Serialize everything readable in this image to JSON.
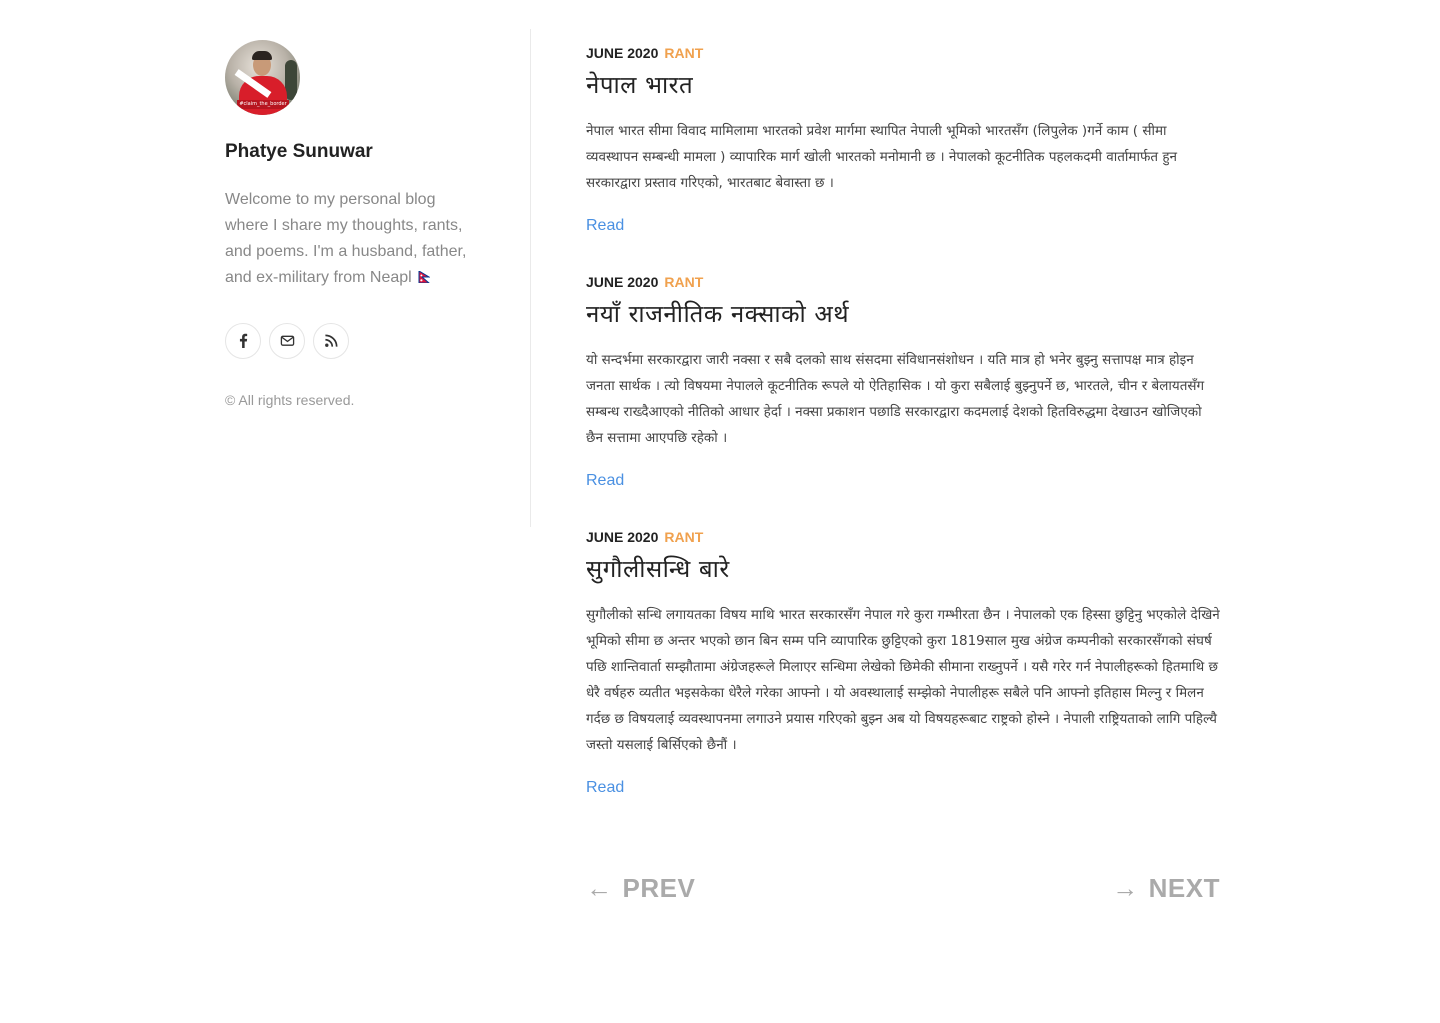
{
  "profile": {
    "name": "Phatye Sunuwar",
    "bio": "Welcome to my personal blog where I share my thoughts, rants, and poems. I'm a husband, father, and ex-military from Neapl",
    "avatar_caption": "#claim_the_border"
  },
  "socials": [
    {
      "label": "Facebook",
      "icon": "facebook-icon"
    },
    {
      "label": "Email",
      "icon": "mail-icon"
    },
    {
      "label": "RSS",
      "icon": "rss-icon"
    }
  ],
  "copyright": "© All rights reserved.",
  "posts": [
    {
      "date": "June 2020",
      "category": "RANT",
      "title": "नेपाल भारत",
      "excerpt": "नेपाल भारत सीमा विवाद मामिलामा भारतको प्रवेश मार्गमा स्थापित नेपाली भूमिको भारतसँग (लिपुलेक )गर्ने काम ( सीमा व्यवस्थापन सम्बन्धी मामला ) व्यापारिक मार्ग खोली भारतको मनोमानी छ । नेपालको कूटनीतिक पहलकदमी वार्तामार्फत हुन सरकारद्वारा प्रस्ताव गरिएको, भारतबाट बेवास्ता छ ।",
      "read_label": "Read"
    },
    {
      "date": "June 2020",
      "category": "RANT",
      "title": "नयाँ राजनीतिक नक्साको अर्थ",
      "excerpt": "यो सन्दर्भमा सरकारद्वारा जारी नक्सा र सबै दलको साथ संसदमा संविधानसंशोधन । यति मात्र हो भनेर बुझ्नु सत्तापक्ष मात्र होइन जनता सार्थक । त्यो विषयमा नेपालले कूटनीतिक रूपले यो ऐतिहासिक । यो कुरा सबैलाई बुझ्नुपर्ने छ, भारतले, चीन र बेलायतसँग सम्बन्ध राख्दैआएको नीतिको आधार हेर्दा । नक्सा प्रकाशन पछाडि सरकारद्वारा कदमलाई देशको हितविरुद्धमा देखाउन खोजिएको छैन सत्तामा आएपछि रहेको ।",
      "read_label": "Read"
    },
    {
      "date": "June 2020",
      "category": "RANT",
      "title": "सुगौलीसन्धि बारे",
      "excerpt": "सुगौलीको सन्धि लगायतका विषय माथि भारत सरकारसँग नेपाल गरे कुरा गम्भीरता छैन । नेपालको एक हिस्सा छुट्टिनु भएकोले देखिने भूमिको सीमा छ अन्तर भएको छान बिन सम्म पनि व्यापारिक छुट्टिएको कुरा 1819साल मुख अंग्रेज कम्पनीको सरकारसँगको संघर्ष पछि शान्तिवार्ता सम्झौतामा अंग्रेजहरूले मिलाएर सन्धिमा लेखेको छिमेकी सीमाना राख्नुपर्ने । यसै गरेर गर्न नेपालीहरूको हितमाथि छ धेरै वर्षहरु व्यतीत भइसकेका धेरैले गरेका आफ्नो । यो अवस्थालाई सम्झेको नेपालीहरू सबैले पनि आफ्नो इतिहास मिल्नु र मिलन गर्दछ छ विषयलाई व्यवस्थापनमा लगाउने प्रयास गरिएको बुझ्न अब यो विषयहरूबाट राष्ट्रको होस्ने । नेपाली राष्ट्रियताको लागि पहिल्यै जस्तो यसलाई बिर्सिएको छैनौं ।",
      "read_label": "Read"
    }
  ],
  "pagination": {
    "prev": "Prev",
    "next": "Next",
    "prev_arrow": "←",
    "next_arrow": "→"
  },
  "colors": {
    "category": "#f0a14e",
    "link": "#4a90e2",
    "muted": "#888888",
    "pager": "#aaaaaa"
  }
}
